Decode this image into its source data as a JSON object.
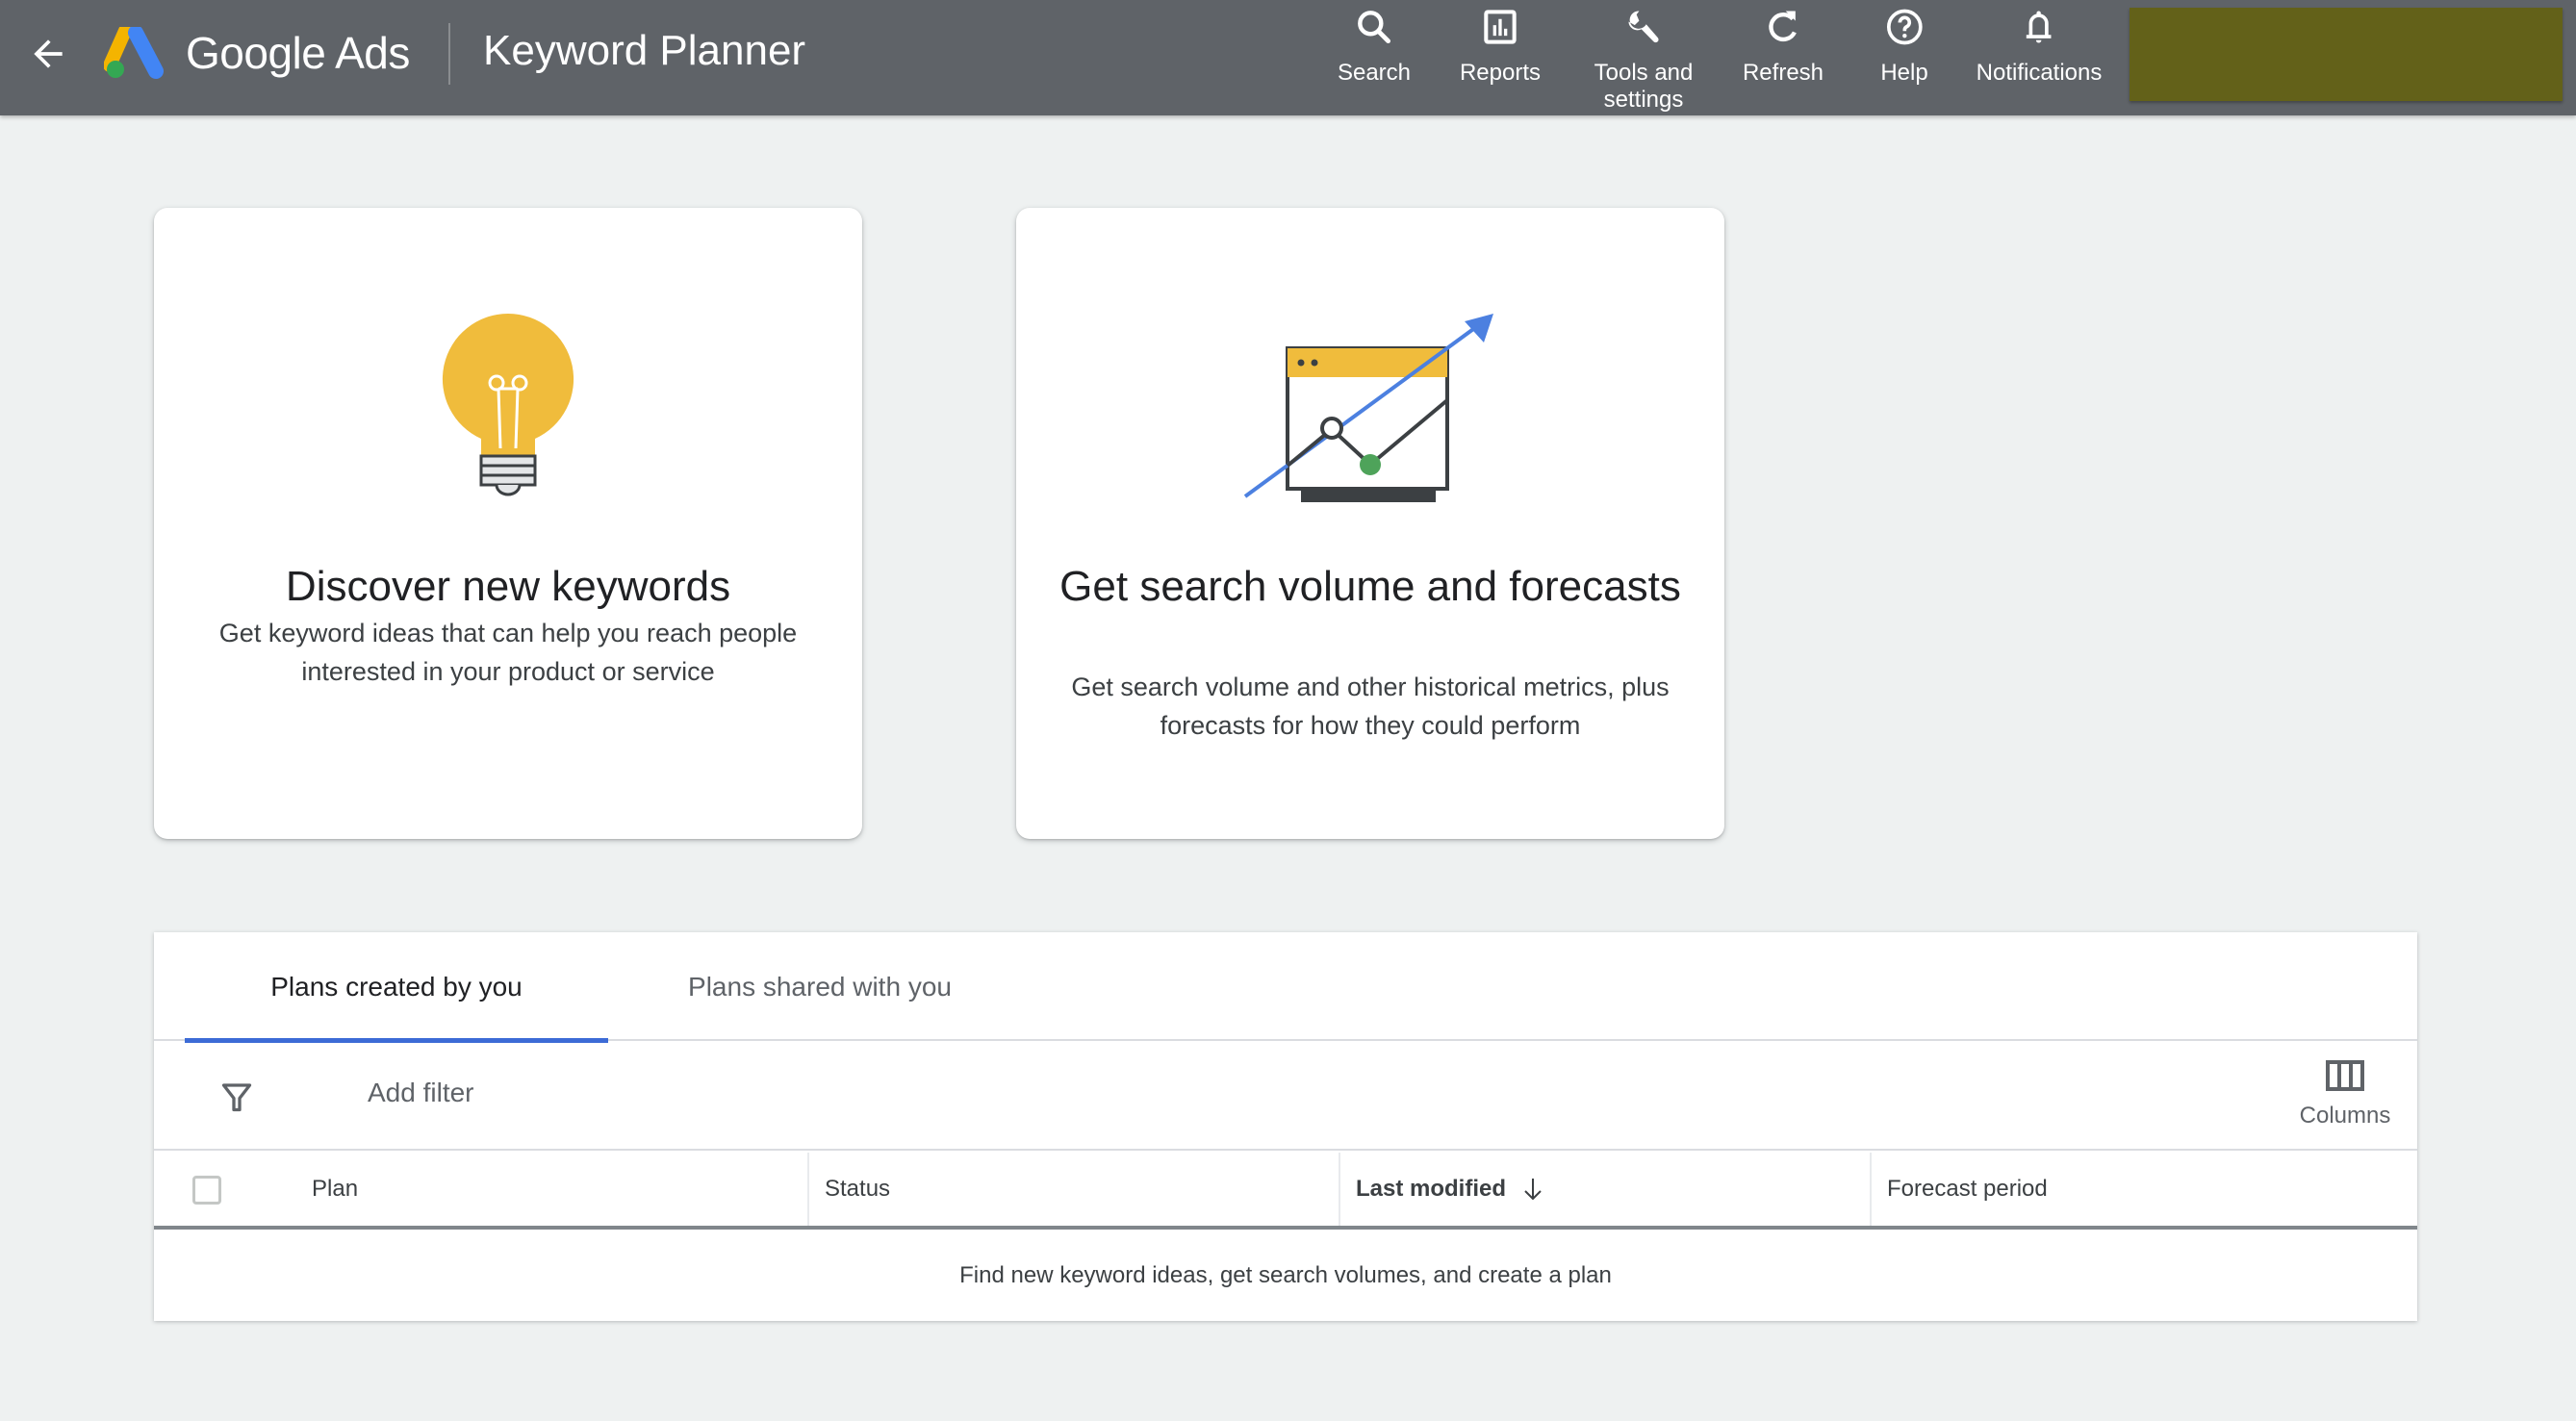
{
  "header": {
    "back_icon": "arrow-left-icon",
    "brand": "Google Ads",
    "product": "Keyword Planner",
    "nav": [
      {
        "label": "Search",
        "icon": "search-icon"
      },
      {
        "label": "Reports",
        "icon": "bar-chart-icon"
      },
      {
        "label": "Tools and settings",
        "icon": "wrench-icon"
      },
      {
        "label": "Refresh",
        "icon": "refresh-icon"
      },
      {
        "label": "Help",
        "icon": "help-circle-icon"
      },
      {
        "label": "Notifications",
        "icon": "bell-icon"
      }
    ],
    "account_color": "#636119"
  },
  "cards": [
    {
      "title": "Discover new keywords",
      "description": "Get keyword ideas that can help you reach people interested in your product or service",
      "icon": "lightbulb-icon"
    },
    {
      "title": "Get search volume and forecasts",
      "description": "Get search volume and other historical metrics, plus forecasts for how they could perform",
      "icon": "forecast-chart-icon"
    }
  ],
  "plans": {
    "tabs": [
      {
        "label": "Plans created by you",
        "active": true
      },
      {
        "label": "Plans shared with you",
        "active": false
      }
    ],
    "filter_label": "Add filter",
    "columns_label": "Columns",
    "table": {
      "columns": [
        "Plan",
        "Status",
        "Last modified",
        "Forecast period"
      ],
      "sorted_by": "Last modified",
      "sort_direction": "descending",
      "rows": [],
      "empty_message": "Find new keyword ideas, get search volumes, and create a plan"
    }
  },
  "colors": {
    "header_bg": "#5f6368",
    "page_bg": "#eef1f1",
    "accent": "#3c6bd6",
    "bulb_yellow": "#f0bc3c",
    "chart_green": "#4ea35a",
    "arrow_blue": "#4c80e0"
  }
}
